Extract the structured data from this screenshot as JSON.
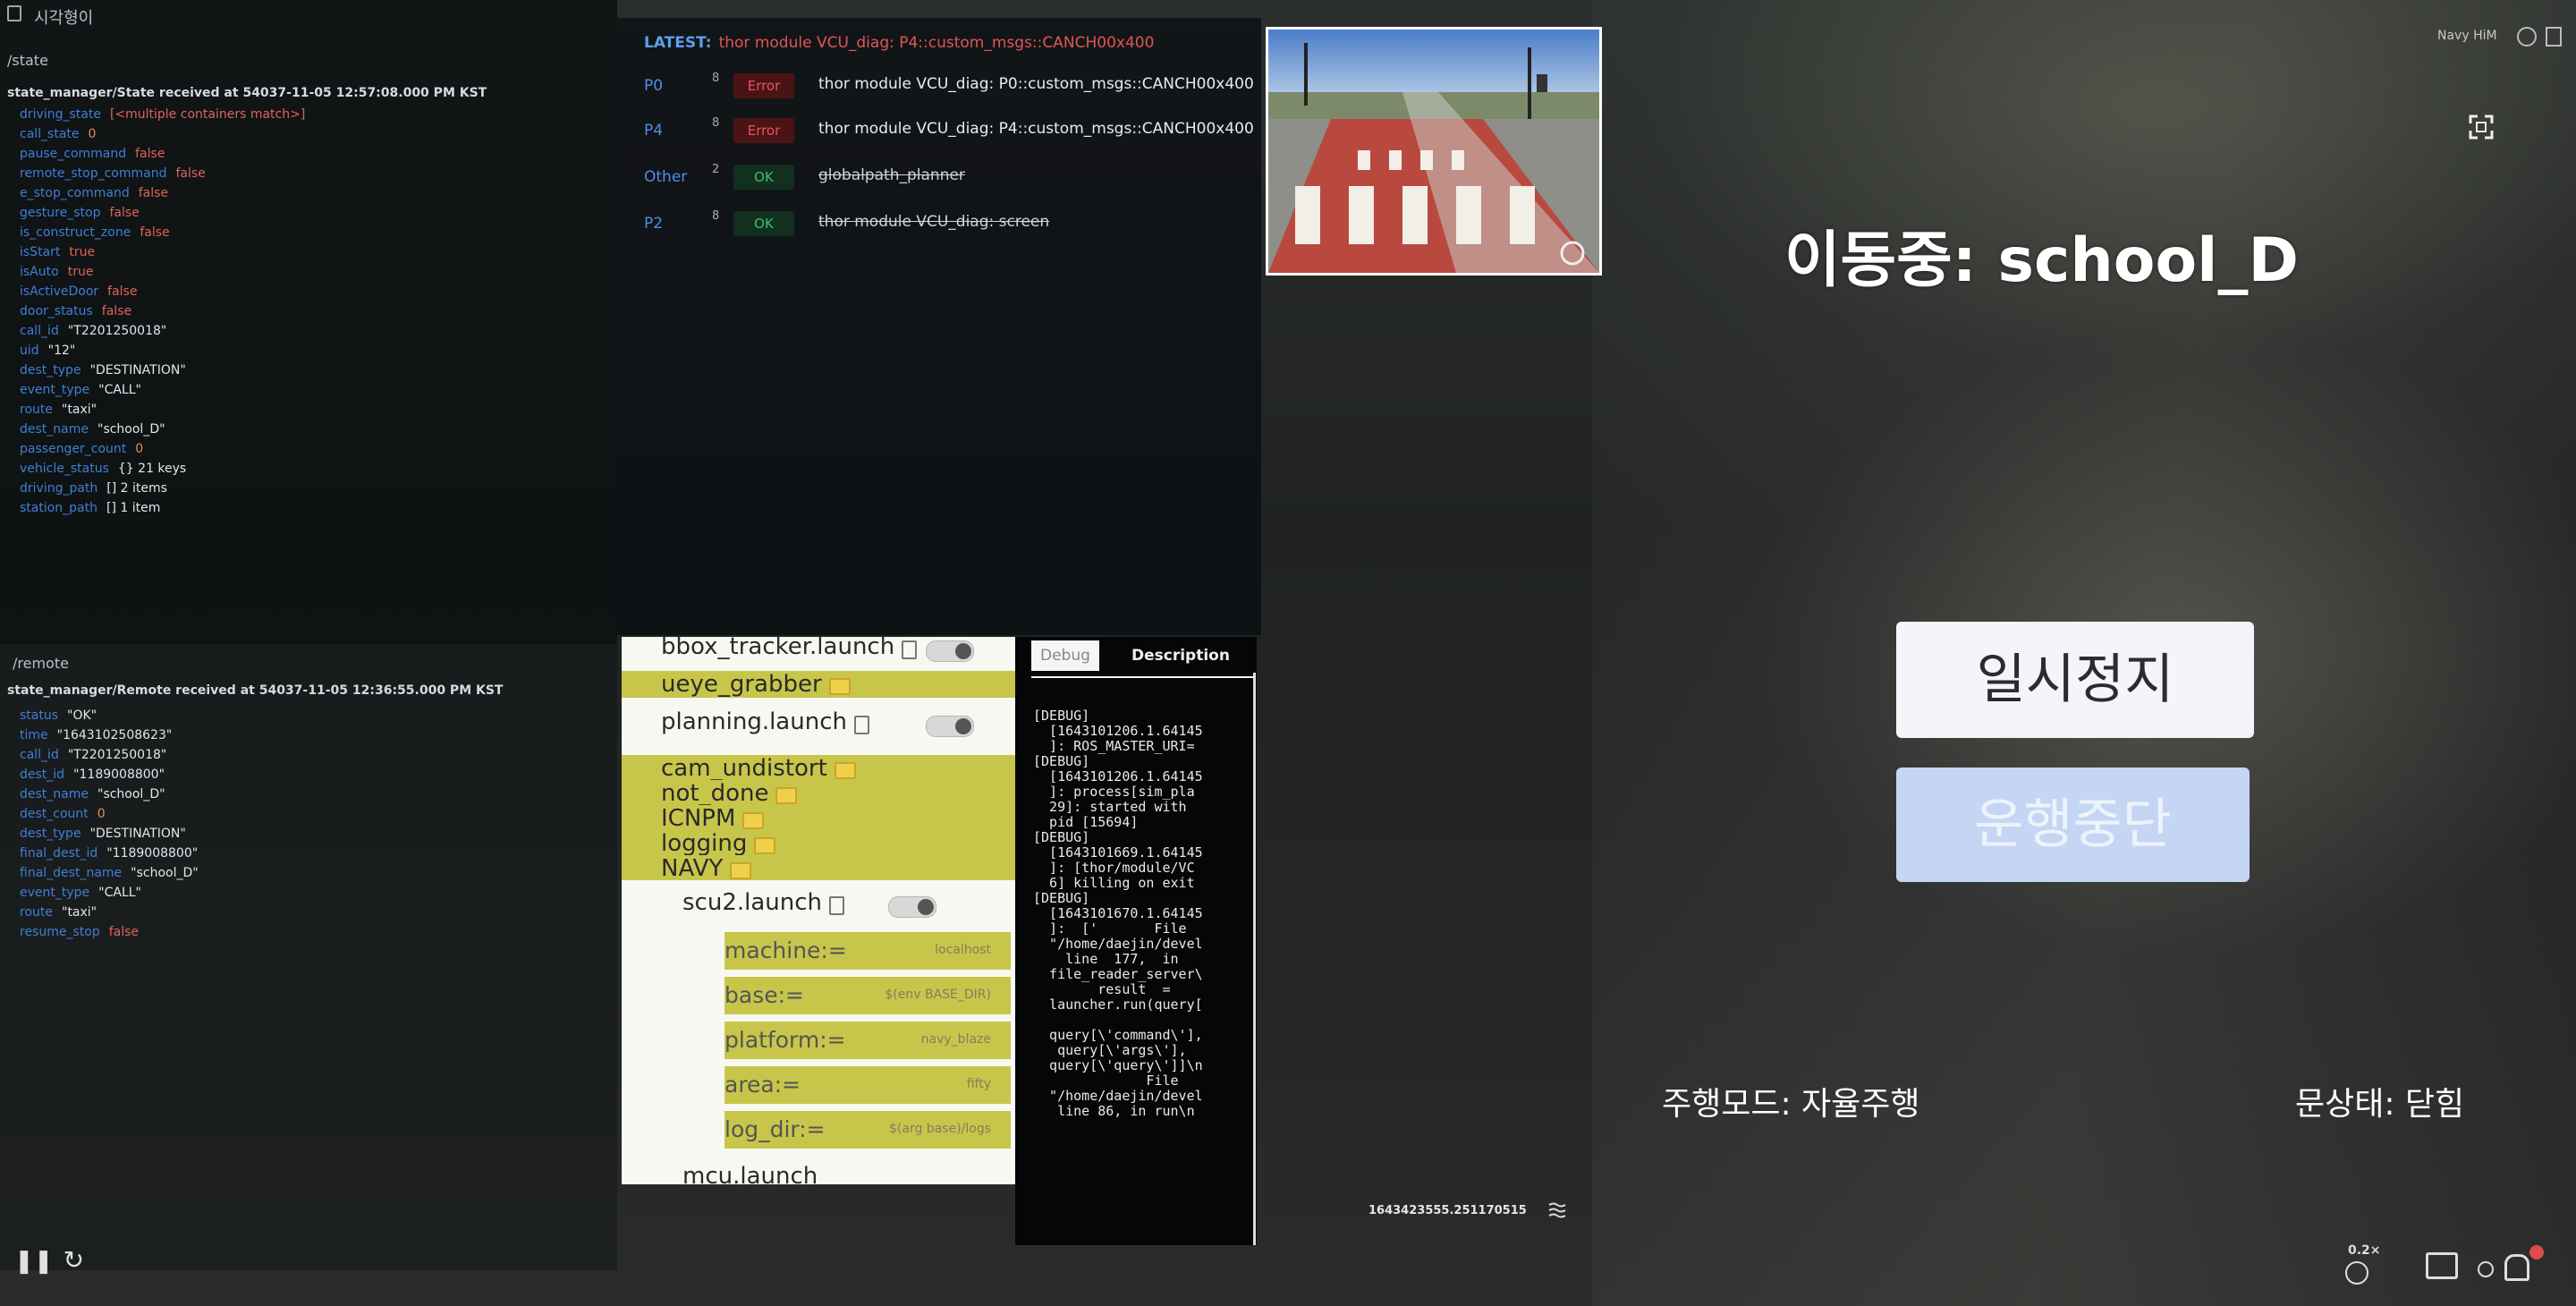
{
  "state_panel": {
    "app_title": "시각형이",
    "topic": "/state",
    "received": "state_manager/State received at 54037-11-05 12:57:08.000 PM KST",
    "fields": [
      {
        "key": "driving_state",
        "value": "[<multiple containers match>]",
        "kind": "bool"
      },
      {
        "key": "call_state",
        "value": "0",
        "kind": "num"
      },
      {
        "key": "pause_command",
        "value": "false",
        "kind": "bool"
      },
      {
        "key": "remote_stop_command",
        "value": "false",
        "kind": "bool"
      },
      {
        "key": "e_stop_command",
        "value": "false",
        "kind": "bool"
      },
      {
        "key": "gesture_stop",
        "value": "false",
        "kind": "bool"
      },
      {
        "key": "is_construct_zone",
        "value": "false",
        "kind": "bool"
      },
      {
        "key": "isStart",
        "value": "true",
        "kind": "bool"
      },
      {
        "key": "isAuto",
        "value": "true",
        "kind": "bool"
      },
      {
        "key": "isActiveDoor",
        "value": "false",
        "kind": "bool"
      },
      {
        "key": "door_status",
        "value": "false",
        "kind": "bool"
      },
      {
        "key": "call_id",
        "value": "\"T2201250018\"",
        "kind": "str"
      },
      {
        "key": "uid",
        "value": "\"12\"",
        "kind": "str"
      },
      {
        "key": "dest_type",
        "value": "\"DESTINATION\"",
        "kind": "str"
      },
      {
        "key": "event_type",
        "value": "\"CALL\"",
        "kind": "str"
      },
      {
        "key": "route",
        "value": "\"taxi\"",
        "kind": "str"
      },
      {
        "key": "dest_name",
        "value": "\"school_D\"",
        "kind": "str"
      },
      {
        "key": "passenger_count",
        "value": "0",
        "kind": "num"
      },
      {
        "key": "vehicle_status",
        "value": "{} 21 keys",
        "kind": "str"
      },
      {
        "key": "driving_path",
        "value": "[] 2 items",
        "kind": "str"
      },
      {
        "key": "station_path",
        "value": "[] 1 item",
        "kind": "str"
      }
    ]
  },
  "remote_panel": {
    "topic": "/remote",
    "received": "state_manager/Remote received at 54037-11-05 12:36:55.000 PM KST",
    "fields": [
      {
        "key": "status",
        "value": "\"OK\"",
        "kind": "str"
      },
      {
        "key": "time",
        "value": "\"1643102508623\"",
        "kind": "str"
      },
      {
        "key": "call_id",
        "value": "\"T2201250018\"",
        "kind": "str"
      },
      {
        "key": "dest_id",
        "value": "\"1189008800\"",
        "kind": "str"
      },
      {
        "key": "dest_name",
        "value": "\"school_D\"",
        "kind": "str"
      },
      {
        "key": "dest_count",
        "value": "0",
        "kind": "num"
      },
      {
        "key": "dest_type",
        "value": "\"DESTINATION\"",
        "kind": "str"
      },
      {
        "key": "final_dest_id",
        "value": "\"1189008800\"",
        "kind": "str"
      },
      {
        "key": "final_dest_name",
        "value": "\"school_D\"",
        "kind": "str"
      },
      {
        "key": "event_type",
        "value": "\"CALL\"",
        "kind": "str"
      },
      {
        "key": "route",
        "value": "\"taxi\"",
        "kind": "str"
      },
      {
        "key": "resume_stop",
        "value": "false",
        "kind": "bool"
      }
    ]
  },
  "diagnostics": {
    "latest_label": "LATEST:",
    "latest_message": "thor module VCU_diag: P4::custom_msgs::CANCH00x400",
    "rows": [
      {
        "priority": "P0",
        "count": "8",
        "status": "Error",
        "status_kind": "err",
        "text": "thor module VCU_diag: P0::custom_msgs::CANCH00x400",
        "strike": false
      },
      {
        "priority": "P4",
        "count": "8",
        "status": "Error",
        "status_kind": "err",
        "text": "thor module VCU_diag: P4::custom_msgs::CANCH00x400",
        "strike": false
      },
      {
        "priority": "Other",
        "count": "2",
        "status": "OK",
        "status_kind": "ok",
        "text": "globalpath_planner",
        "strike": true
      },
      {
        "priority": "P2",
        "count": "8",
        "status": "OK",
        "status_kind": "ok",
        "text": "thor module VCU_diag: screen",
        "strike": true
      }
    ]
  },
  "launch_tree": {
    "items": [
      {
        "label": "bbox_tracker.launch",
        "icon": "file",
        "highlight": false,
        "toggle": true
      },
      {
        "label": "ueye_grabber",
        "icon": "folder",
        "highlight": true,
        "toggle": false
      },
      {
        "label": "planning.launch",
        "icon": "file",
        "highlight": false,
        "toggle": true
      },
      {
        "label": "cam_undistort",
        "icon": "folder",
        "highlight": true,
        "toggle": false
      },
      {
        "label": "not_done",
        "icon": "folder",
        "highlight": true,
        "toggle": false
      },
      {
        "label": "ICNPM",
        "icon": "folder",
        "highlight": true,
        "toggle": false
      },
      {
        "label": "logging",
        "icon": "folder",
        "highlight": true,
        "toggle": false
      },
      {
        "label": "NAVY",
        "icon": "folder",
        "highlight": true,
        "toggle": false
      },
      {
        "label": "scu2.launch",
        "icon": "file",
        "highlight": false,
        "toggle": true
      }
    ],
    "args": [
      {
        "name": "machine:=",
        "value": "localhost"
      },
      {
        "name": "base:=",
        "value": "$(env BASE_DIR)"
      },
      {
        "name": "platform:=",
        "value": "navy_blaze"
      },
      {
        "name": "area:=",
        "value": "fifty"
      },
      {
        "name": "log_dir:=",
        "value": "$(arg base)/logs"
      }
    ],
    "last_item": "mcu.launch"
  },
  "debug": {
    "tab_debug": "Debug",
    "tab_description": "Description",
    "log": "[DEBUG]\n  [1643101206.1.64145\n  ]: ROS_MASTER_URI=\n[DEBUG]\n  [1643101206.1.64145\n  ]: process[sim_pla\n  29]: started with\n  pid [15694]\n[DEBUG]\n  [1643101669.1.64145\n  ]: [thor/module/VC\n  6] killing on exit\n[DEBUG]\n  [1643101670.1.64145\n  ]:  ['       File\n  \"/home/daejin/devel\n    line  177,  in\n  file_reader_server\\\n        result  =\n  launcher.run(query[\n\n  query[\\'command\\'],\n   query[\\'args\\'],\n  query[\\'query\\']]\\n\n              File\n  \"/home/daejin/devel\n   line 86, in run\\n"
  },
  "camera": {
    "timestamp": "1643423555.251170515"
  },
  "overlay": {
    "status_title": "이동중: school_D",
    "pause_label": "일시정지",
    "stop_label": "운행중단",
    "drive_mode": "주행모드: 자율주행",
    "door_state": "문상태: 닫힘",
    "top_right_label": "Navy HiM",
    "zoom": "0.2×"
  },
  "colors": {
    "accent_blue": "#3f7fd6",
    "error_red": "#e3555a",
    "ok_green": "#3fbf6a",
    "tree_highlight": "#c8c64a"
  }
}
